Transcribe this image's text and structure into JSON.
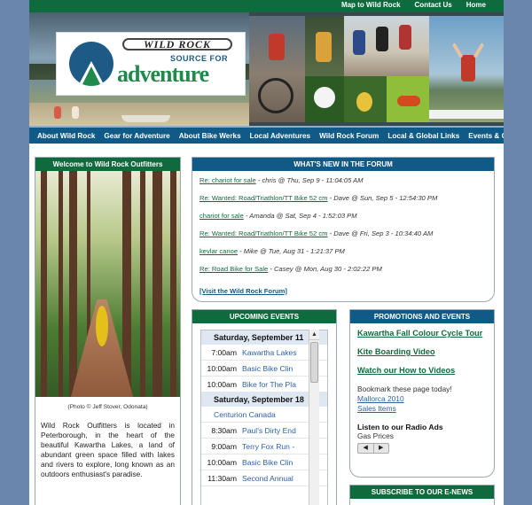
{
  "top_links": [
    "Map to Wild Rock",
    "Contact Us",
    "Home"
  ],
  "logo": {
    "wordmark": "WILD ROCK",
    "tagline_small": "SOURCE FOR",
    "tagline_big": "adventure"
  },
  "nav": [
    "About Wild Rock",
    "Gear for Adventure",
    "About Bike Werks",
    "Local Adventures",
    "Wild Rock Forum",
    "Local & Global Links",
    "Events & Clubs"
  ],
  "welcome": {
    "title": "Welcome to Wild Rock Outfitters",
    "photo_credit": "(Photo © Jeff Stover, Odonata)",
    "text": "Wild Rock Outfitters is located in Peterborough, in the heart of the beautiful Kawartha Lakes, a land of abundant green space filled with lakes and rivers to explore, long known as an outdoors enthusiast's paradise."
  },
  "forum": {
    "title": "WHAT'S NEW IN THE FORUM",
    "posts": [
      {
        "link": "Re: chariot for sale",
        "meta": " - chris @ Thu, Sep 9 - 11:04:05 AM"
      },
      {
        "link": "Re: Wanted: Road/Triathlon/TT Bike 52 cm",
        "meta": " - Dave @ Sun, Sep 5 - 12:54:30 PM"
      },
      {
        "link": "chariot for sale",
        "meta": " - Amanda @ Sat, Sep 4 - 1:52:03 PM"
      },
      {
        "link": "Re: Wanted: Road/Triathlon/TT Bike 52 cm",
        "meta": " - Dave @ Fri, Sep 3 - 10:34:40 AM"
      },
      {
        "link": "kevlar canoe",
        "meta": " - Mike @ Tue, Aug 31 - 1:21:37 PM"
      },
      {
        "link": "Re: Road Bike for Sale",
        "meta": " - Casey @ Mon, Aug 30 - 2:02:22 PM"
      }
    ],
    "visit": "[Visit the Wild Rock Forum]"
  },
  "events": {
    "title": "UPCOMING EVENTS",
    "day1": "Saturday, September 11",
    "day1_rows": [
      {
        "time": "7:00am",
        "name": "Kawartha Lakes"
      },
      {
        "time": "10:00am",
        "name": "Basic Bike Clin"
      },
      {
        "time": "10:00am",
        "name": "Bike for The Pla"
      }
    ],
    "day2": "Saturday, September 18",
    "day2_allday": "Centurion Canada",
    "day2_rows": [
      {
        "time": "8:30am",
        "name": "Paul's Dirty End"
      },
      {
        "time": "9:00am",
        "name": "Terry Fox Run -"
      },
      {
        "time": "10:00am",
        "name": "Basic Bike Clin"
      },
      {
        "time": "11:30am",
        "name": "Second Annual"
      }
    ]
  },
  "promos": {
    "title": "PROMOTIONS AND EVENTS",
    "links": [
      "Kawartha Fall Colour Cycle Tour",
      "Kite Boarding Video",
      "Watch our How to Videos"
    ],
    "bookmark_text": "Bookmark these page today!",
    "bookmark_links": [
      "Mallorca 2010",
      "Sales Items"
    ],
    "radio": "Listen to our Radio Ads",
    "gas": "Gas Prices",
    "pager_prev": "◀",
    "pager_next": "▶"
  },
  "enews": {
    "title": "SUBSCRIBE TO OUR E-NEWS"
  },
  "scroll": {
    "up": "▲",
    "down": "▼"
  },
  "colors": {
    "green": "#0f6b3e",
    "blue": "#0f5a86",
    "background": "#6b86ad"
  }
}
